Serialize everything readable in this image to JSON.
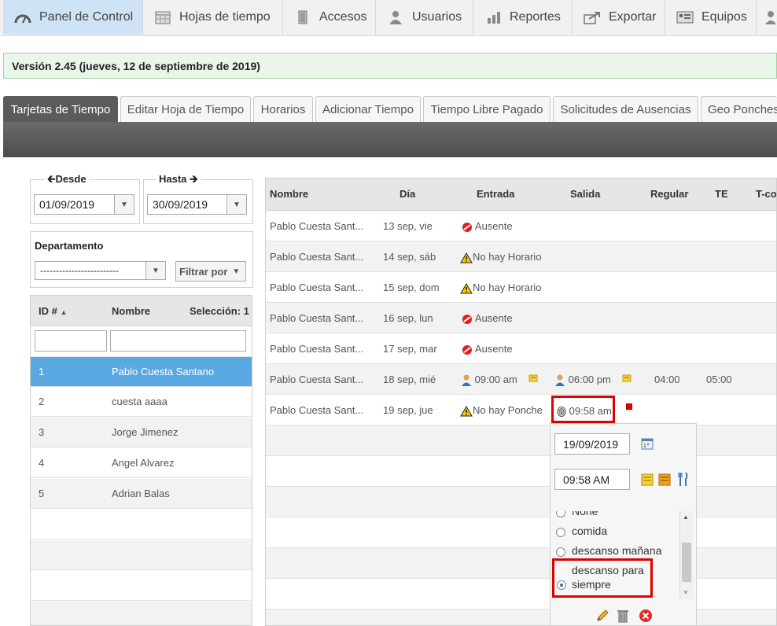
{
  "nav": {
    "items": [
      {
        "label": "Panel de Control",
        "icon": "dashboard-icon"
      },
      {
        "label": "Hojas de tiempo",
        "icon": "calendar-icon"
      },
      {
        "label": "Accesos",
        "icon": "door-icon"
      },
      {
        "label": "Usuarios",
        "icon": "user-icon"
      },
      {
        "label": "Reportes",
        "icon": "bar-chart-icon"
      },
      {
        "label": "Exportar",
        "icon": "export-icon"
      },
      {
        "label": "Equipos",
        "icon": "device-icon"
      }
    ]
  },
  "version": "Versión 2.45 (jueves, 12 de septiembre de 2019)",
  "tabs": [
    "Tarjetas de Tiempo",
    "Editar Hoja de Tiempo",
    "Horarios",
    "Adicionar Tiempo",
    "Tiempo Libre Pagado",
    "Solicitudes de Ausencias",
    "Geo Ponches"
  ],
  "filters": {
    "from_label": "Desde",
    "from_value": "01/09/2019",
    "to_label": "Hasta",
    "to_value": "30/09/2019",
    "dept_label": "Departamento",
    "dept_value": "-------------------------",
    "filter_button": "Filtrar por"
  },
  "employees": {
    "headers": {
      "id": "ID #",
      "name": "Nombre",
      "selection": "Selección: 1"
    },
    "rows": [
      {
        "id": "1",
        "name": "Pablo Cuesta Santano"
      },
      {
        "id": "2",
        "name": "cuesta aaaa"
      },
      {
        "id": "3",
        "name": "Jorge Jimenez"
      },
      {
        "id": "4",
        "name": "Angel Alvarez"
      },
      {
        "id": "5",
        "name": "Adrian Balas"
      }
    ]
  },
  "grid": {
    "headers": {
      "name": "Nombre",
      "day": "Día",
      "in": "Entrada",
      "out": "Salida",
      "regular": "Regular",
      "te": "TE",
      "tc": "T-co"
    },
    "rows": [
      {
        "name": "Pablo Cuesta Sant...",
        "day": "13 sep, vie",
        "in": "Ausente",
        "in_icon": "absent-icon"
      },
      {
        "name": "Pablo Cuesta Sant...",
        "day": "14 sep, sáb",
        "in": "No hay Horario",
        "in_icon": "warning-icon"
      },
      {
        "name": "Pablo Cuesta Sant...",
        "day": "15 sep, dom",
        "in": "No hay Horario",
        "in_icon": "warning-icon"
      },
      {
        "name": "Pablo Cuesta Sant...",
        "day": "16 sep, lun",
        "in": "Ausente",
        "in_icon": "absent-icon"
      },
      {
        "name": "Pablo Cuesta Sant...",
        "day": "17 sep, mar",
        "in": "Ausente",
        "in_icon": "absent-icon"
      },
      {
        "name": "Pablo Cuesta Sant...",
        "day": "18 sep, mié",
        "in": "09:00 am",
        "out": "06:00 pm",
        "regular": "04:00",
        "te": "05:00"
      },
      {
        "name": "Pablo Cuesta Sant...",
        "day": "19 sep, jue",
        "in": "No hay Ponche",
        "in_icon": "warning-icon",
        "out": "09:58 am"
      }
    ]
  },
  "popup": {
    "date": "19/09/2019",
    "time": "09:58 AM",
    "options": [
      "None",
      "comida",
      "descanso mañana",
      "descanso para siempre"
    ],
    "selected": "descanso para siempre"
  },
  "colors": {
    "selected_row": "#5aa8e2",
    "highlight_box": "#e00000",
    "active_tab": "#5b5b5b"
  }
}
